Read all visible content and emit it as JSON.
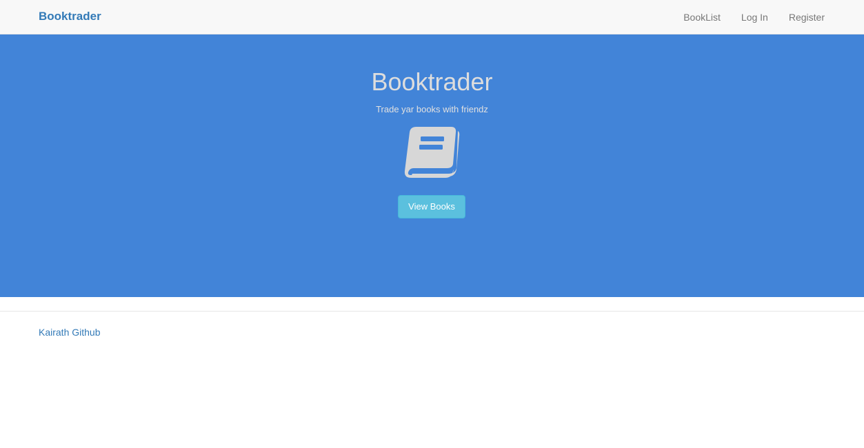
{
  "navbar": {
    "brand": "Booktrader",
    "links": [
      {
        "label": "BookList"
      },
      {
        "label": "Log In"
      },
      {
        "label": "Register"
      }
    ]
  },
  "hero": {
    "title": "Booktrader",
    "subtitle": "Trade yar books with friendz",
    "icon": "book-icon",
    "button_label": "View Books",
    "background_color": "#4284d8",
    "button_color": "#5bc0de"
  },
  "footer": {
    "link_label": "Kairath Github"
  }
}
